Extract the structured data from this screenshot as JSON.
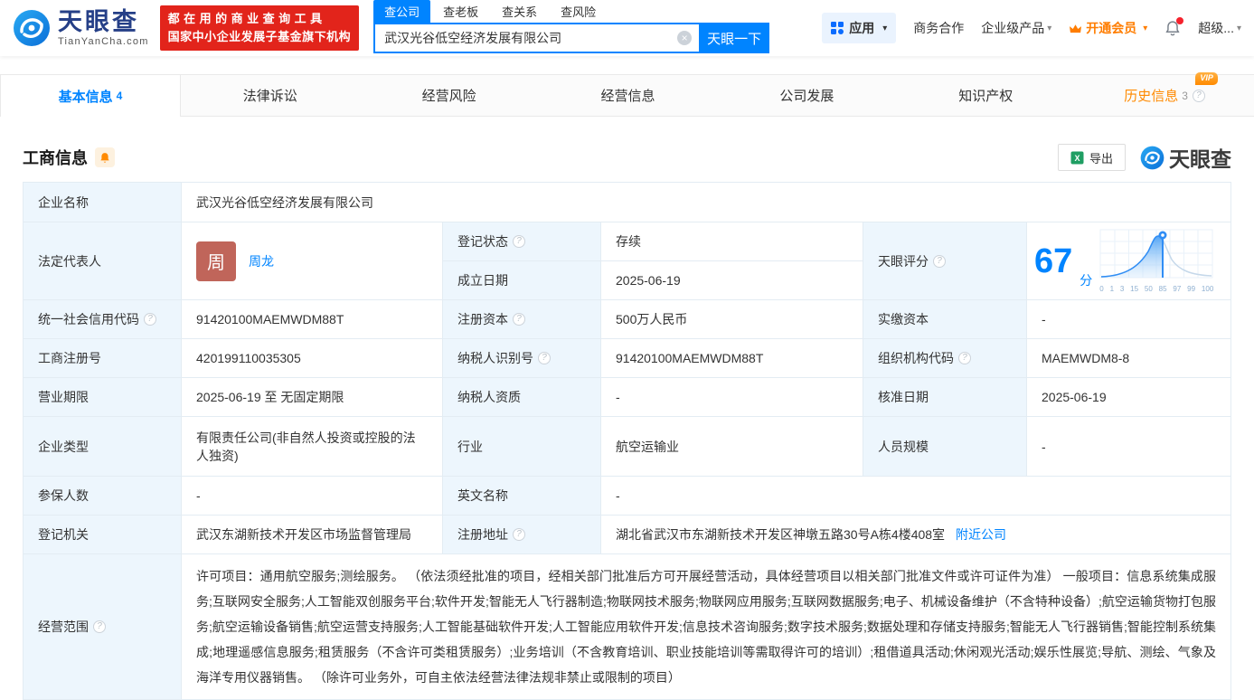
{
  "icons": {
    "help": "?",
    "caret": "▾",
    "clear": "×",
    "vip_badge": "VIP"
  },
  "header": {
    "logo": {
      "brand": "天眼查",
      "domain": "TianYanCha.com"
    },
    "slogan_line1": "都在用的商业查询工具",
    "slogan_line2": "国家中小企业发展子基金旗下机构",
    "search_tabs": [
      {
        "label": "查公司",
        "active": true
      },
      {
        "label": "查老板",
        "active": false
      },
      {
        "label": "查关系",
        "active": false
      },
      {
        "label": "查风险",
        "active": false
      }
    ],
    "search_value": "武汉光谷低空经济发展有限公司",
    "search_button": "天眼一下",
    "nav_apps": "应用",
    "nav_biz": "商务合作",
    "nav_enterprise": "企业级产品",
    "nav_vip": "开通会员",
    "nav_user": "超级..."
  },
  "page_tabs": [
    {
      "label": "基本信息",
      "count": "4",
      "state": "active"
    },
    {
      "label": "法律诉讼",
      "count": "",
      "state": ""
    },
    {
      "label": "经营风险",
      "count": "",
      "state": ""
    },
    {
      "label": "经营信息",
      "count": "",
      "state": ""
    },
    {
      "label": "公司发展",
      "count": "",
      "state": ""
    },
    {
      "label": "知识产权",
      "count": "",
      "state": ""
    },
    {
      "label": "历史信息",
      "count": "3",
      "state": "vip"
    }
  ],
  "section": {
    "title": "工商信息",
    "export_label": "导出",
    "watermark_brand": "天眼查"
  },
  "info": {
    "company_name_label": "企业名称",
    "company_name": "武汉光谷低空经济发展有限公司",
    "legal_rep_label": "法定代表人",
    "legal_rep_avatar_char": "周",
    "legal_rep_name": "周龙",
    "reg_status_label": "登记状态",
    "reg_status_value": "存续",
    "establish_label": "成立日期",
    "establish_value": "2025-06-19",
    "score_label": "天眼评分",
    "score_value": "67",
    "score_unit": "分",
    "credit_code_label": "统一社会信用代码",
    "credit_code_value": "91420100MAEMWDM88T",
    "reg_capital_label": "注册资本",
    "reg_capital_value": "500万人民币",
    "paid_capital_label": "实缴资本",
    "paid_capital_value": "-",
    "reg_number_label": "工商注册号",
    "reg_number_value": "420199110035305",
    "taxpayer_id_label": "纳税人识别号",
    "taxpayer_id_value": "91420100MAEMWDM88T",
    "org_code_label": "组织机构代码",
    "org_code_value": "MAEMWDM8-8",
    "business_term_label": "营业期限",
    "business_term_value": "2025-06-19 至 无固定期限",
    "taxpayer_quali_label": "纳税人资质",
    "taxpayer_quali_value": "-",
    "approval_date_label": "核准日期",
    "approval_date_value": "2025-06-19",
    "company_type_label": "企业类型",
    "company_type_value": "有限责任公司(非自然人投资或控股的法人独资)",
    "industry_label": "行业",
    "industry_value": "航空运输业",
    "staff_size_label": "人员规模",
    "staff_size_value": "-",
    "insured_label": "参保人数",
    "insured_value": "-",
    "english_name_label": "英文名称",
    "english_name_value": "-",
    "reg_authority_label": "登记机关",
    "reg_authority_value": "武汉东湖新技术开发区市场监督管理局",
    "address_label": "注册地址",
    "address_value": "湖北省武汉市东湖新技术开发区神墩五路30号A栋4楼408室",
    "address_link": "附近公司",
    "scope_label": "经营范围",
    "scope_value": "许可项目：通用航空服务;测绘服务。 （依法须经批准的项目，经相关部门批准后方可开展经营活动，具体经营项目以相关部门批准文件或许可证件为准） 一般项目：信息系统集成服务;互联网安全服务;人工智能双创服务平台;软件开发;智能无人飞行器制造;物联网技术服务;物联网应用服务;互联网数据服务;电子、机械设备维护（不含特种设备）;航空运输货物打包服务;航空运输设备销售;航空运营支持服务;人工智能基础软件开发;人工智能应用软件开发;信息技术咨询服务;数字技术服务;数据处理和存储支持服务;智能无人飞行器销售;智能控制系统集成;地理遥感信息服务;租赁服务（不含许可类租赁服务）;业务培训（不含教育培训、职业技能培训等需取得许可的培训）;租借道具活动;休闲观光活动;娱乐性展览;导航、测绘、气象及海洋专用仪器销售。 （除许可业务外，可自主依法经营法律法规非禁止或限制的项目）"
  },
  "score_chart": {
    "type": "area",
    "description": "天眼评分分布曲线，当前评分标记",
    "score": 67,
    "x_ticks": [
      "0",
      "1",
      "3",
      "15",
      "50",
      "85",
      "97",
      "99",
      "100"
    ]
  }
}
